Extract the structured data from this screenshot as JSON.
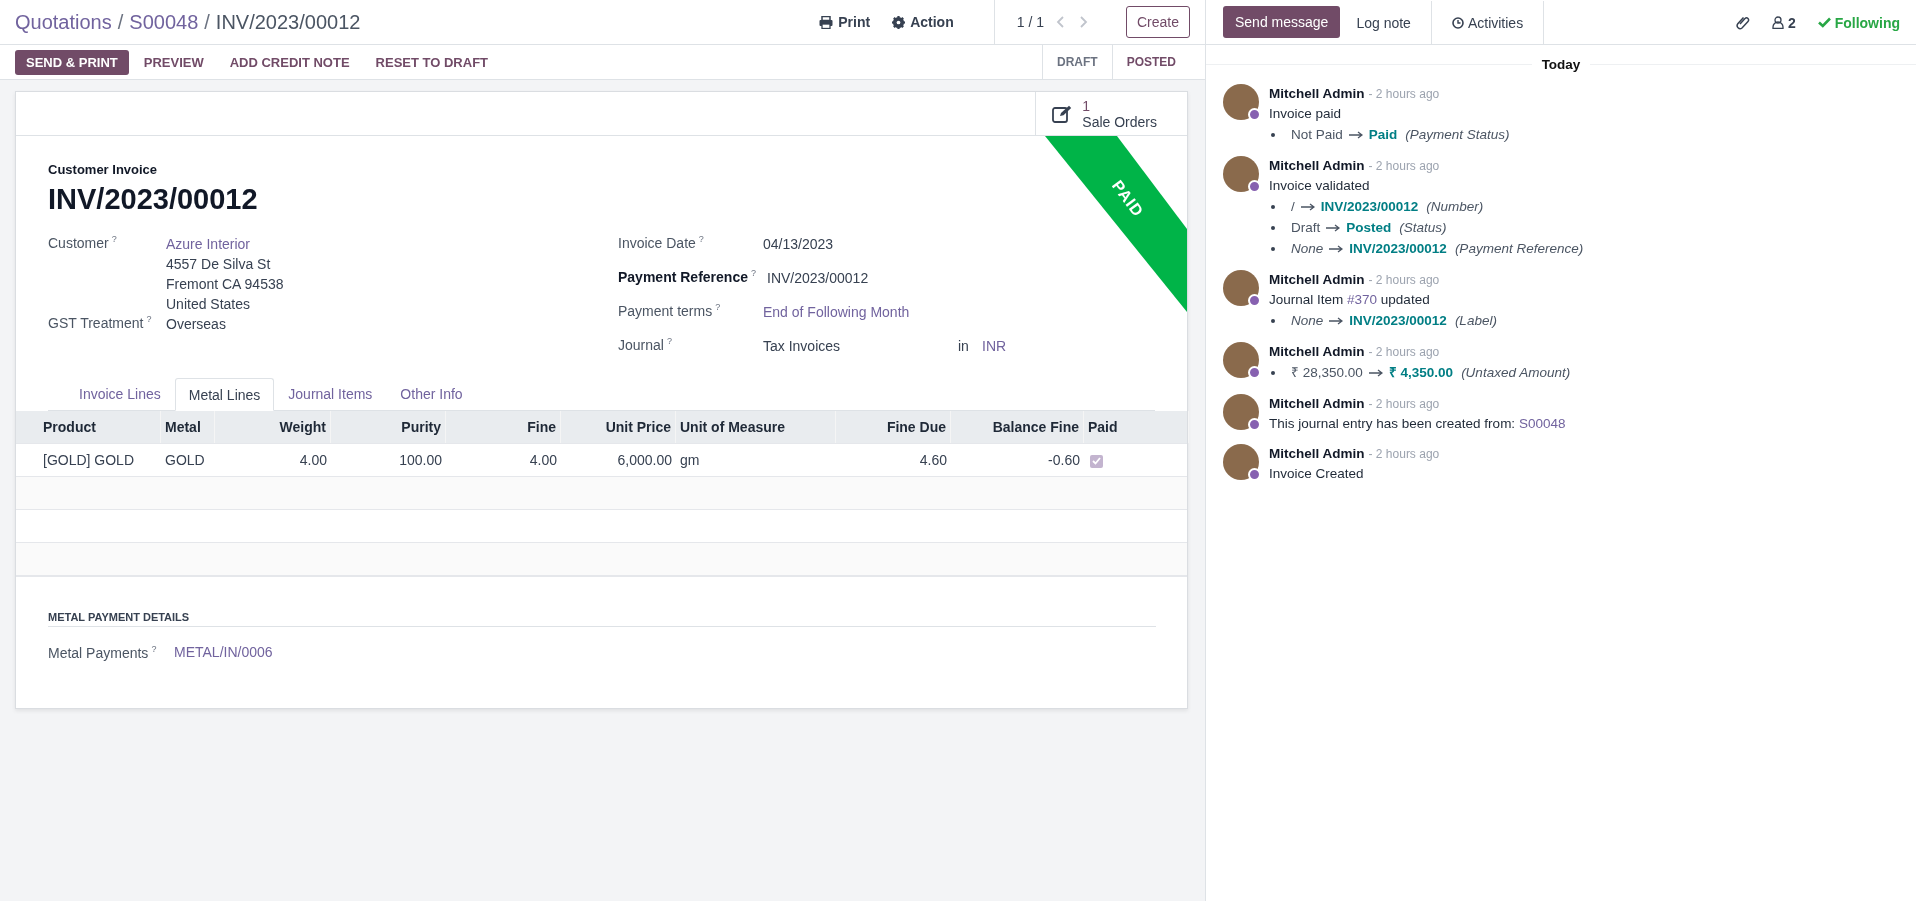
{
  "breadcrumb": {
    "separator": "/",
    "items": [
      {
        "label": "Quotations",
        "link": true
      },
      {
        "label": "S00048",
        "link": true
      },
      {
        "label": "INV/2023/00012",
        "link": false
      }
    ]
  },
  "toolbar": {
    "print": "Print",
    "action": "Action",
    "pager": "1 / 1",
    "create": "Create"
  },
  "header_buttons": [
    {
      "label": "SEND & PRINT",
      "kind": "primary"
    },
    {
      "label": "PREVIEW",
      "kind": "secondary"
    },
    {
      "label": "ADD CREDIT NOTE",
      "kind": "secondary"
    },
    {
      "label": "RESET TO DRAFT",
      "kind": "secondary"
    }
  ],
  "status_steps": [
    {
      "label": "DRAFT",
      "selected": false
    },
    {
      "label": "POSTED",
      "selected": true
    }
  ],
  "smart_button": {
    "count": "1",
    "label": "Sale Orders"
  },
  "ribbon": "PAID",
  "subtitle": "Customer Invoice",
  "title": "INV/2023/00012",
  "left_fields": [
    {
      "label": "Customer",
      "help": "?",
      "required": false,
      "value": "Azure Interior",
      "link": true,
      "extra_lines": [
        "4557 De Silva St",
        "Fremont CA 94538",
        "United States"
      ]
    },
    {
      "label": "GST Treatment",
      "help": "?",
      "required": false,
      "value": "Overseas",
      "link": false
    }
  ],
  "right_fields": [
    {
      "label": "Invoice Date",
      "help": "?",
      "required": false,
      "value": "04/13/2023",
      "link": false
    },
    {
      "label": "Payment Reference",
      "help": "?",
      "required": true,
      "value": "INV/2023/00012",
      "link": false
    },
    {
      "label": "Payment terms",
      "help": "?",
      "required": false,
      "value": "End of Following Month",
      "link": true
    },
    {
      "label": "Journal",
      "help": "?",
      "required": false,
      "value": "Tax Invoices",
      "link": false,
      "suffix_label": "in",
      "suffix_value": "INR"
    }
  ],
  "tabs": [
    {
      "label": "Invoice Lines",
      "selected": false
    },
    {
      "label": "Metal Lines",
      "selected": true
    },
    {
      "label": "Journal Items",
      "selected": false
    },
    {
      "label": "Other Info",
      "selected": false
    }
  ],
  "table": {
    "columns": [
      {
        "label": "Product",
        "numeric": false
      },
      {
        "label": "Metal",
        "numeric": false
      },
      {
        "label": "Weight",
        "numeric": true
      },
      {
        "label": "Purity",
        "numeric": true
      },
      {
        "label": "Fine",
        "numeric": true
      },
      {
        "label": "Unit Price",
        "numeric": true
      },
      {
        "label": "Unit of Measure",
        "numeric": false
      },
      {
        "label": "Fine Due",
        "numeric": true
      },
      {
        "label": "Balance Fine",
        "numeric": true
      },
      {
        "label": "Paid",
        "numeric": false
      }
    ],
    "rows": [
      {
        "cells": [
          "[GOLD] GOLD",
          "GOLD",
          "4.00",
          "100.00",
          "4.00",
          "6,000.00",
          "gm",
          "4.60",
          "-0.60"
        ],
        "paid": true
      }
    ]
  },
  "section": {
    "title": "METAL PAYMENT DETAILS",
    "fields": [
      {
        "label": "Metal Payments",
        "help": "?",
        "value": "METAL/IN/0006"
      }
    ]
  },
  "chatter": {
    "buttons": [
      {
        "label": "Send message",
        "kind": "primary"
      },
      {
        "label": "Log note",
        "kind": "tab"
      },
      {
        "label": "Activities",
        "kind": "tab-clock"
      }
    ],
    "followers": "2",
    "following": "Following",
    "date_separator": "Today",
    "messages": [
      {
        "author": "Mitchell Admin",
        "time": "- 2 hours ago",
        "body": [
          {
            "text": "Invoice paid",
            "link": false
          }
        ],
        "changes": [
          {
            "old": "Not Paid",
            "old_empty": false,
            "new": "Paid",
            "field": "(Payment Status)"
          }
        ]
      },
      {
        "author": "Mitchell Admin",
        "time": "- 2 hours ago",
        "body": [
          {
            "text": "Invoice validated",
            "link": false
          }
        ],
        "changes": [
          {
            "old": "/",
            "old_empty": false,
            "new": "INV/2023/00012",
            "field": "(Number)"
          },
          {
            "old": "Draft",
            "old_empty": false,
            "new": "Posted",
            "field": "(Status)"
          },
          {
            "old": "None",
            "old_empty": true,
            "new": "INV/2023/00012",
            "field": "(Payment Reference)"
          }
        ]
      },
      {
        "author": "Mitchell Admin",
        "time": "- 2 hours ago",
        "body": [
          {
            "text": "Journal Item ",
            "link": false
          },
          {
            "text": "#370",
            "link": true
          },
          {
            "text": " updated",
            "link": false
          }
        ],
        "changes": [
          {
            "old": "None",
            "old_empty": true,
            "new": "INV/2023/00012",
            "field": "(Label)"
          }
        ]
      },
      {
        "author": "Mitchell Admin",
        "time": "- 2 hours ago",
        "changes": [
          {
            "old": "₹ 28,350.00",
            "old_empty": false,
            "new": "₹ 4,350.00",
            "field": "(Untaxed Amount)"
          }
        ]
      },
      {
        "author": "Mitchell Admin",
        "time": "- 2 hours ago",
        "body": [
          {
            "text": "This journal entry has been created from: ",
            "link": false
          },
          {
            "text": "S00048",
            "link": true
          }
        ]
      },
      {
        "author": "Mitchell Admin",
        "time": "- 2 hours ago",
        "body": [
          {
            "text": "Invoice Created",
            "link": false
          }
        ]
      }
    ]
  }
}
